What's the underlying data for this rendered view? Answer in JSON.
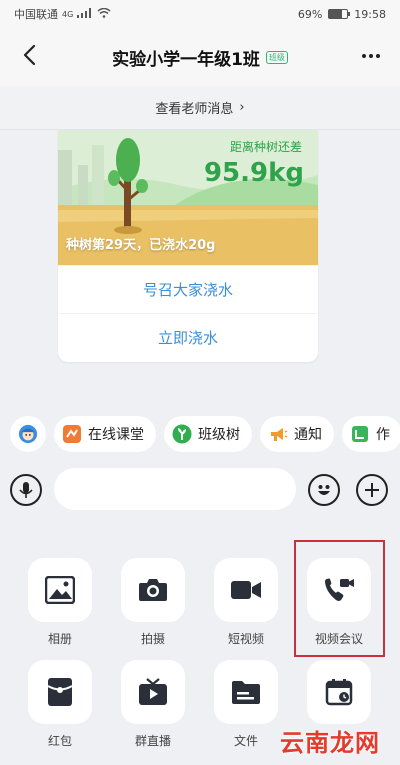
{
  "status_bar": {
    "carrier": "中国联通",
    "network": "4G",
    "battery": "69%",
    "battery_level": 0.69,
    "time": "19:58"
  },
  "header": {
    "title": "实验小学一年级1班",
    "badge": "班级"
  },
  "teacher_bar": {
    "label": "查看老师消息",
    "chevron": "›"
  },
  "tree_card": {
    "distance_label": "距离种树还差",
    "distance_value": "95.9kg",
    "water_status": "种树第29天，已浇水20g",
    "call_everyone": "号召大家浇水",
    "water_now": "立即浇水"
  },
  "quick_tabs": [
    {
      "icon": "assistant-avatar-icon",
      "label": ""
    },
    {
      "icon": "online-class-icon",
      "label": "在线课堂"
    },
    {
      "icon": "class-tree-icon",
      "label": "班级树"
    },
    {
      "icon": "megaphone-icon",
      "label": "通知"
    },
    {
      "icon": "homework-icon",
      "label": "作"
    }
  ],
  "input": {
    "placeholder": ""
  },
  "tools": [
    {
      "icon": "image-icon",
      "label": "相册"
    },
    {
      "icon": "camera-icon",
      "label": "拍摄"
    },
    {
      "icon": "video-camera-icon",
      "label": "短视频"
    },
    {
      "icon": "video-call-icon",
      "label": "视频会议"
    },
    {
      "icon": "red-packet-icon",
      "label": "红包"
    },
    {
      "icon": "tv-live-icon",
      "label": "群直播"
    },
    {
      "icon": "folder-icon",
      "label": "文件"
    },
    {
      "icon": "calendar-icon",
      "label": ""
    }
  ],
  "watermark": "云南龙网",
  "colors": {
    "accent_green": "#2fa24a",
    "link_blue": "#3a8fd8",
    "highlight_red": "#c8323a"
  }
}
